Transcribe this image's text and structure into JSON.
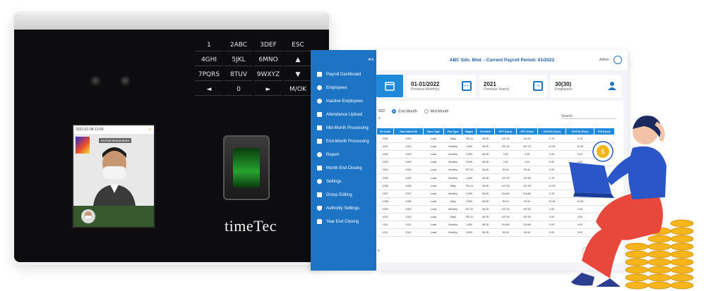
{
  "device": {
    "brand": "timeTec",
    "keys": [
      "1",
      "2ABC",
      "3DEF",
      "ESC",
      "4GHI",
      "5JKL",
      "6MNO",
      "▲",
      "7PQRS",
      "8TUV",
      "9WXYZ",
      "▼",
      "◄",
      "0",
      "►",
      "M/OK"
    ],
    "screen": {
      "datetime": "2021-01-08  12:00",
      "status": "Normal temperature"
    }
  },
  "sidebar": {
    "collapse_icon": "arrow-left-icon",
    "items": [
      {
        "label": "Payroll Dashboard"
      },
      {
        "label": "Employees"
      },
      {
        "label": "Inactive Employees"
      },
      {
        "label": "Attendance Upload"
      },
      {
        "label": "Mid-Month Processing"
      },
      {
        "label": "End-Month Processing"
      },
      {
        "label": "Report"
      },
      {
        "label": "Month End Closing"
      },
      {
        "label": "Settings"
      },
      {
        "label": "Group Editing"
      },
      {
        "label": "Authority Settings"
      },
      {
        "label": "Year End Closing"
      }
    ]
  },
  "header": {
    "title": "ABC Sdn. Bhd. - Current Payroll Period:",
    "period": "01/2022",
    "user": "Admin"
  },
  "cards": [
    {
      "value": "01-01/2022",
      "label": "Previous Month(s)",
      "icon": "MTH"
    },
    {
      "value": "2021",
      "label": "Previous Year(s)",
      "icon": "YR"
    },
    {
      "value": "30(30)",
      "label": "Employees",
      "icon": "employee-icon"
    }
  ],
  "filters": {
    "year_fragment": "022",
    "options": [
      "End Month",
      "Mid Month"
    ],
    "selected": "End Month",
    "search_label": "Search",
    "show_fragment": "s"
  },
  "table": {
    "columns": [
      "Ee Code",
      "Time Attend ID",
      "Ryee Type",
      "Pay Type",
      "Wages",
      "Overtime",
      "EPF (Fyee)",
      "EPF (Fyer)",
      "SOCSO (Fyee)",
      "SOCSO (Fyer)",
      "EIS (Fyee)"
    ],
    "rows": [
      [
        "1000",
        "1000",
        "Local",
        "Daily",
        "790.41",
        "96.35",
        "141.91",
        "141.91",
        "0.75",
        "0.75",
        ""
      ],
      [
        "1001",
        "1001",
        "Local",
        "Monthly",
        "1,600",
        "96.35",
        "297.23",
        "297.23",
        "12.35",
        "12.35",
        ""
      ],
      [
        "1002",
        "1002",
        "Local",
        "Monthly",
        "3,900",
        "96.35",
        "3.00",
        "3.00",
        "0.00",
        "0.00",
        ""
      ],
      [
        "1003",
        "1003",
        "Local",
        "Monthly",
        "3,900",
        "96.35",
        "3.00",
        "3.00",
        "0.00",
        "0.00",
        ""
      ],
      [
        "1004",
        "1004",
        "Local",
        "Monthly",
        "797.00",
        "96.35",
        "90.44",
        "90.44",
        "0.00",
        "0.00",
        ""
      ],
      [
        "1005",
        "1005",
        "Local",
        "Monthly",
        "1,600",
        "96.35",
        "197.52",
        "197.52",
        "0.75",
        "0.75",
        ""
      ],
      [
        "1006",
        "1006",
        "Local",
        "Daily",
        "790.41",
        "96.35",
        "197.90",
        "197.90",
        "12.35",
        "12.35",
        ""
      ],
      [
        "1007",
        "1007",
        "Local",
        "Monthly",
        "3,900",
        "96.35",
        "216.80",
        "216.80",
        "0.75",
        "0.75",
        ""
      ],
      [
        "1008",
        "1008",
        "Local",
        "Daily",
        "3,900",
        "96.35",
        "90.44",
        "90.44",
        "12.35",
        "12.35",
        ""
      ],
      [
        "1009",
        "1009",
        "Local",
        "Monthly",
        "797.00",
        "96.35",
        "197.52",
        "197.52",
        "0.00",
        "0.00",
        ""
      ],
      [
        "1010",
        "1010",
        "Local",
        "Daily",
        "790.41",
        "96.35",
        "197.90",
        "197.90",
        "0.00",
        "0.00",
        ""
      ],
      [
        "1011",
        "1011",
        "Local",
        "Monthly",
        "1,600",
        "96.35",
        "216.80",
        "216.80",
        "0.00",
        "0.00",
        ""
      ],
      [
        "1012",
        "1012",
        "Local",
        "Monthly",
        "3,900",
        "96.35",
        "90.44",
        "90.44",
        "0.00",
        "0.00",
        ""
      ]
    ],
    "footer_fragment": "s",
    "prev_label": "Pre"
  },
  "colors": {
    "sidebar": "#1e74c4",
    "header_blue": "#1e8ad9",
    "coin": "#f5b51b",
    "person_shirt": "#2b56c8",
    "person_pants": "#e8473b"
  }
}
